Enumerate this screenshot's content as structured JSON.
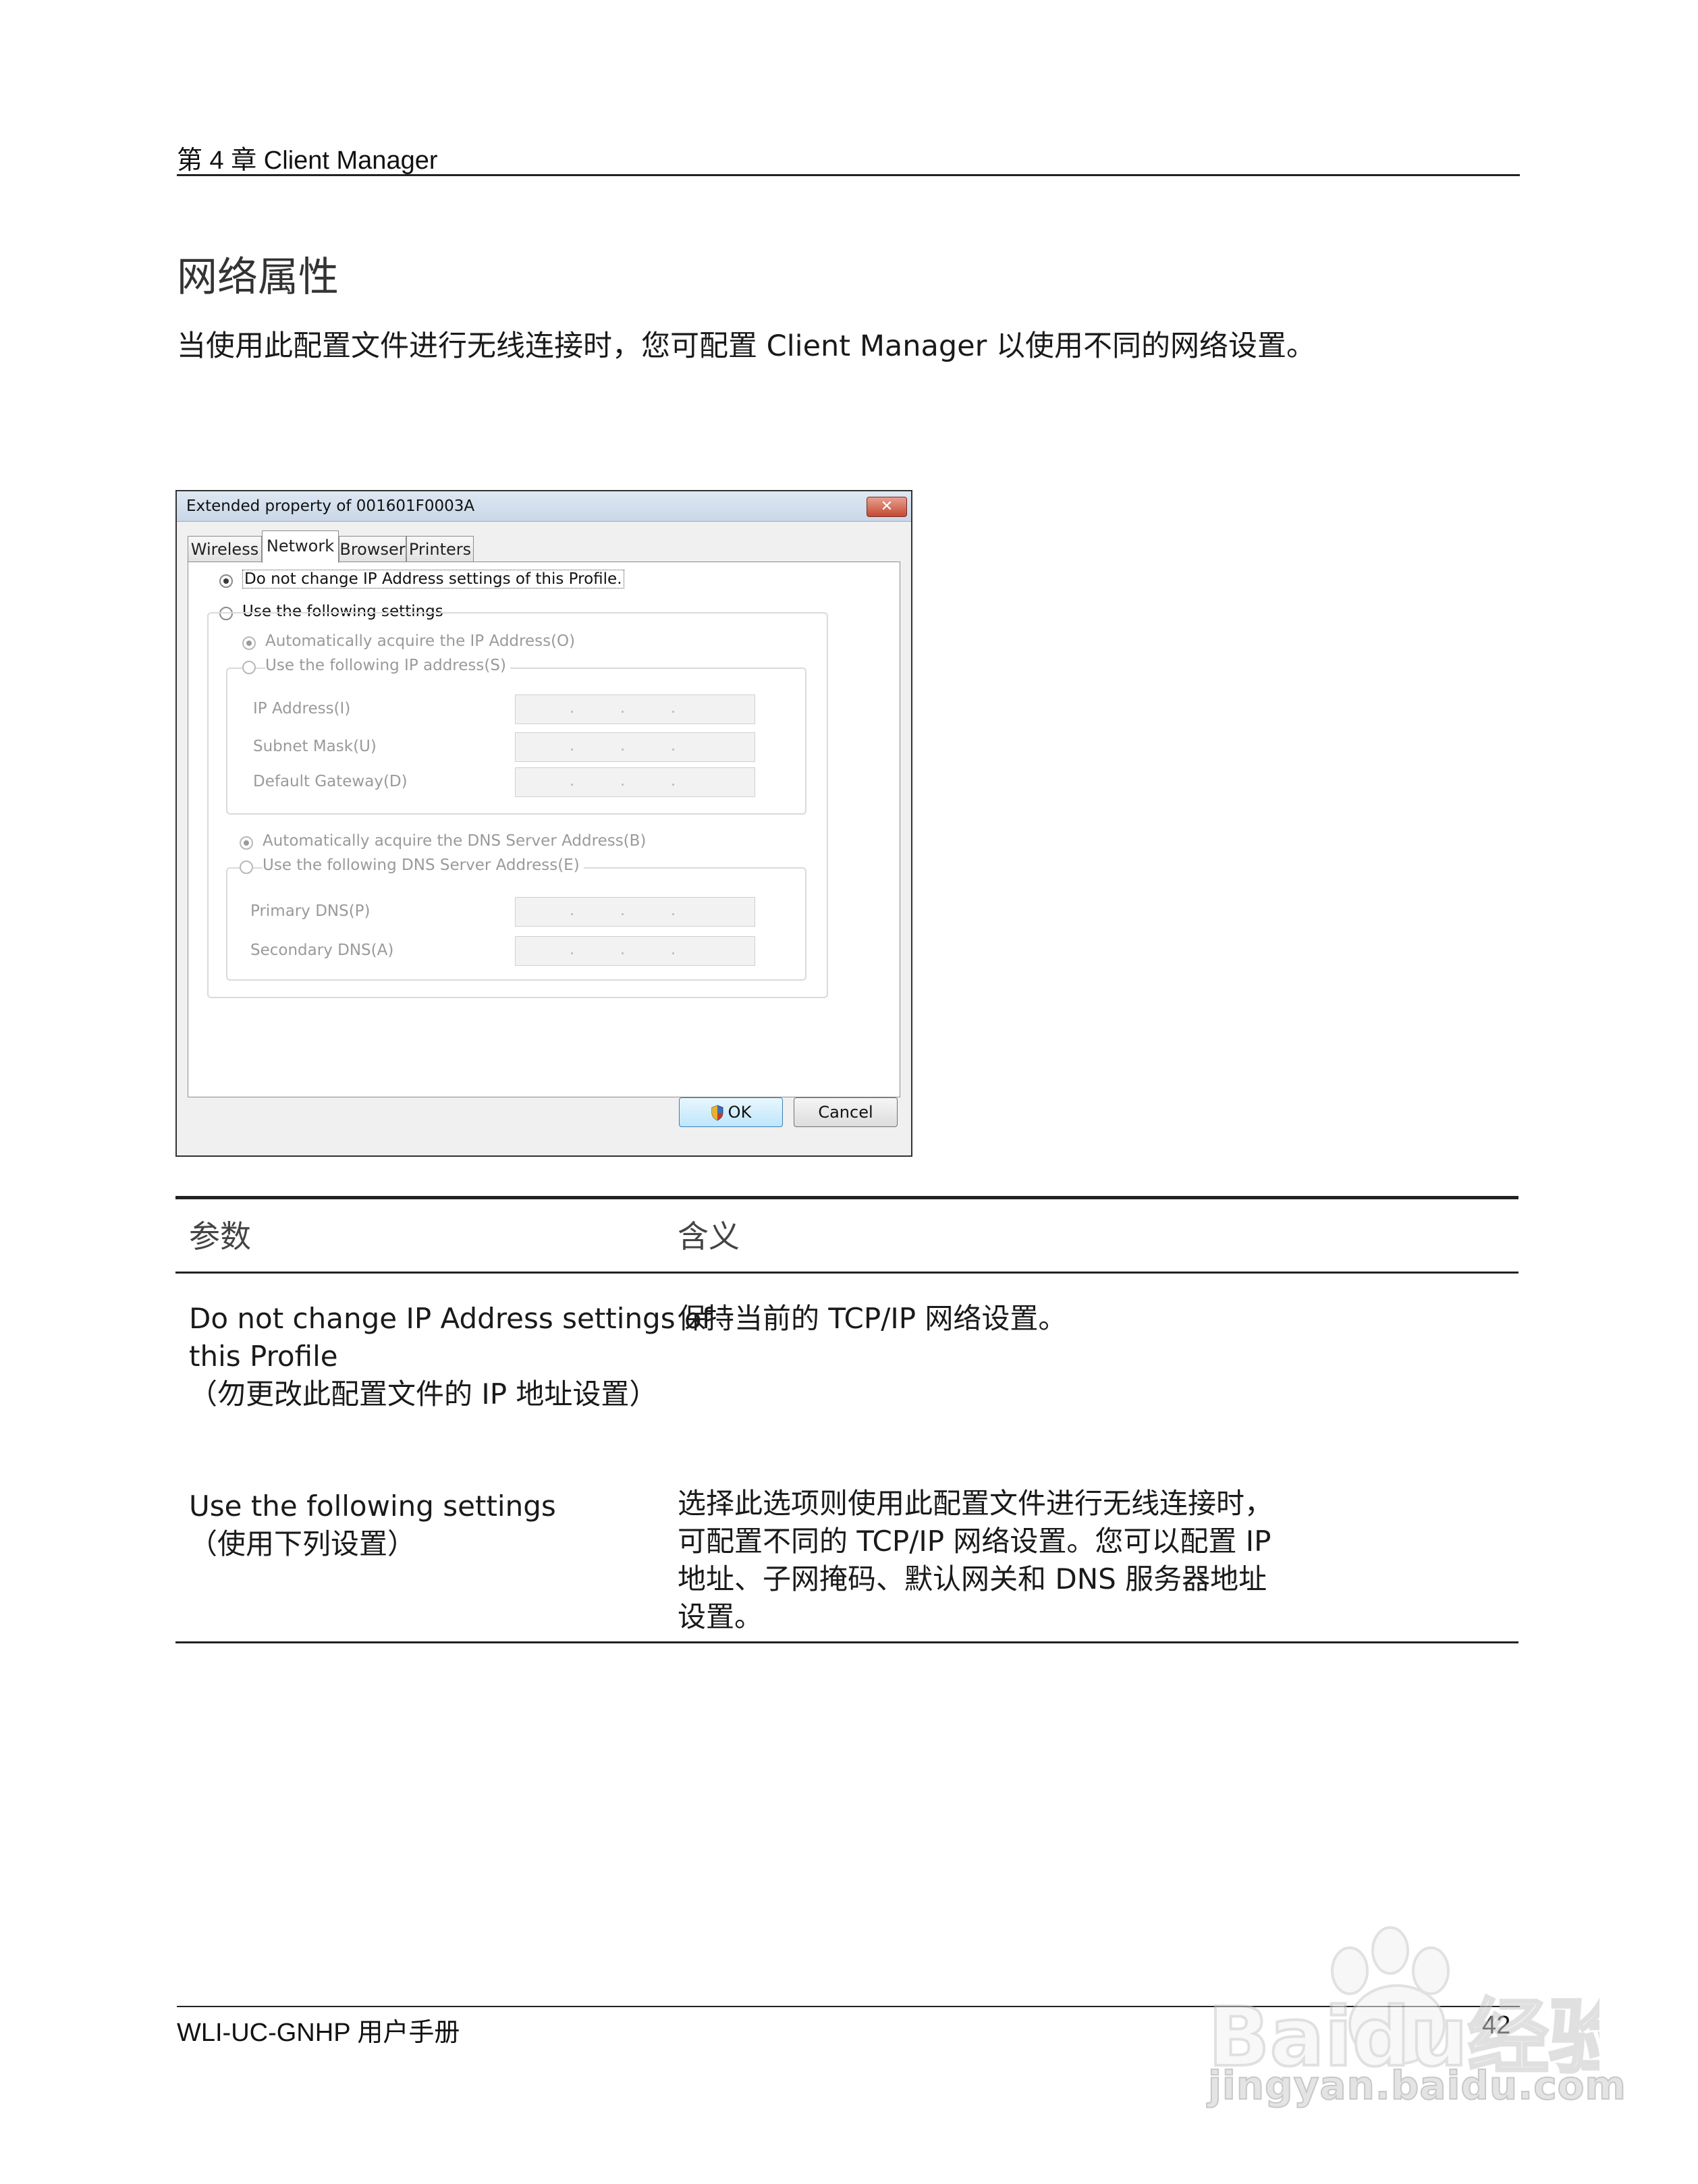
{
  "header": {
    "chapter": "第 4 章 Client Manager"
  },
  "section": {
    "title": "网络属性",
    "intro": "当使用此配置文件进行无线连接时，您可配置 Client Manager 以使用不同的网络设置。"
  },
  "dialog": {
    "title": "Extended property of 001601F0003A",
    "close_glyph": "✕",
    "tabs": [
      "Wireless",
      "Network",
      "Browser",
      "Printers"
    ],
    "active_tab": "Network",
    "options": {
      "no_change": "Do not change IP Address settings of this Profile.",
      "use_following": "Use the following settings",
      "auto_ip": "Automatically acquire the IP Address(O)",
      "manual_ip": "Use the following IP address(S)",
      "auto_dns": "Automatically acquire the DNS Server Address(B)",
      "manual_dns": "Use the following DNS Server Address(E)"
    },
    "fields": {
      "ip_address": "IP Address(I)",
      "subnet_mask": "Subnet Mask(U)",
      "default_gateway": "Default Gateway(D)",
      "primary_dns": "Primary DNS(P)",
      "secondary_dns": "Secondary DNS(A)",
      "empty_value": "..."
    },
    "buttons": {
      "ok": "OK",
      "cancel": "Cancel"
    }
  },
  "table": {
    "headers": {
      "param": "参数",
      "meaning": "含义"
    },
    "rows": [
      {
        "param_lines": [
          "Do not change IP Address settings of",
          "this Profile",
          "（勿更改此配置文件的 IP 地址设置）"
        ],
        "meaning_lines": [
          "保持当前的 TCP/IP 网络设置。"
        ]
      },
      {
        "param_lines": [
          "Use the following settings",
          "（使用下列设置）"
        ],
        "meaning_lines": [
          "选择此选项则使用此配置文件进行无线连接时，",
          "可配置不同的 TCP/IP 网络设置。您可以配置 IP",
          "地址、子网掩码、默认网关和 DNS 服务器地址",
          "设置。"
        ]
      }
    ]
  },
  "footer": {
    "manual": "WLI-UC-GNHP 用户手册",
    "page": "42"
  },
  "watermark": {
    "logo_text": "Baidu经验",
    "url": "jingyan.baidu.com"
  }
}
